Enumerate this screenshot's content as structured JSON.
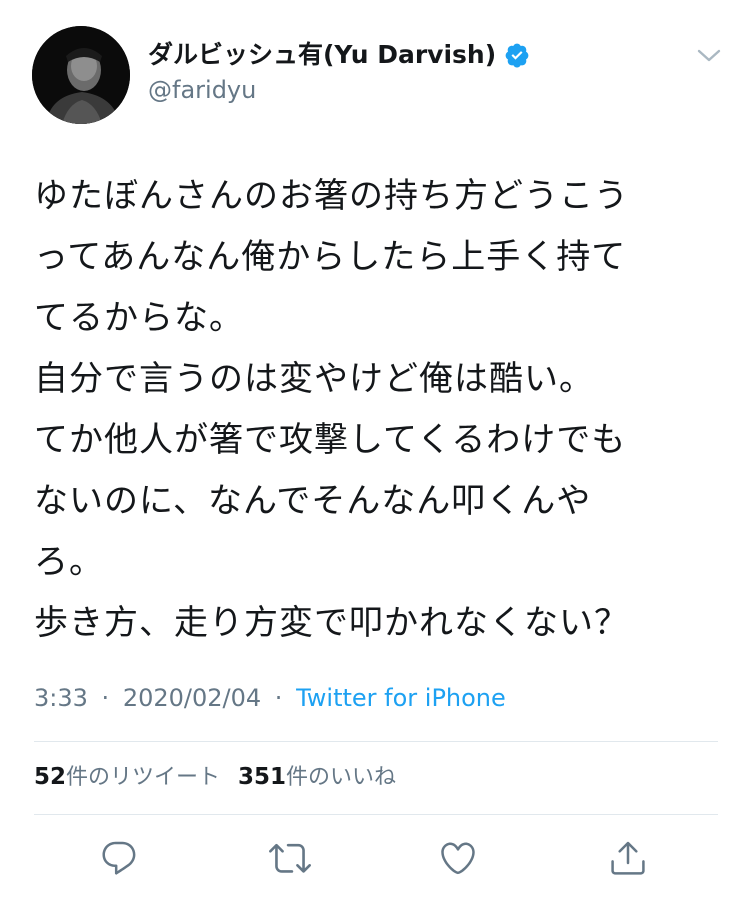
{
  "user": {
    "display_name": "ダルビッシュ有(Yu Darvish)",
    "handle": "@faridyu",
    "verified": true
  },
  "tweet": {
    "lines": [
      "ゆたぼんさんのお箸の持ち方どうこう",
      "ってあんなん俺からしたら上手く持て",
      "てるからな。",
      "自分で言うのは変やけど俺は酷い。",
      "てか他人が箸で攻撃してくるわけでも",
      "ないのに、なんでそんなん叩くんや",
      "ろ。",
      "歩き方、走り方変で叩かれなくない？"
    ],
    "time": "3:33",
    "date": "2020/02/04",
    "separator": "·",
    "source": "Twitter for iPhone"
  },
  "stats": {
    "retweets_count": "52",
    "retweets_label": "件のリツイート",
    "likes_count": "351",
    "likes_label": "件のいいね"
  },
  "actions": [
    {
      "name": "reply",
      "icon": "reply-icon"
    },
    {
      "name": "retweet",
      "icon": "retweet-icon"
    },
    {
      "name": "like",
      "icon": "heart-icon"
    },
    {
      "name": "share",
      "icon": "share-icon"
    }
  ],
  "colors": {
    "text": "#14171a",
    "secondary": "#657786",
    "accent": "#1da1f2",
    "divider": "#e1e8ed"
  }
}
